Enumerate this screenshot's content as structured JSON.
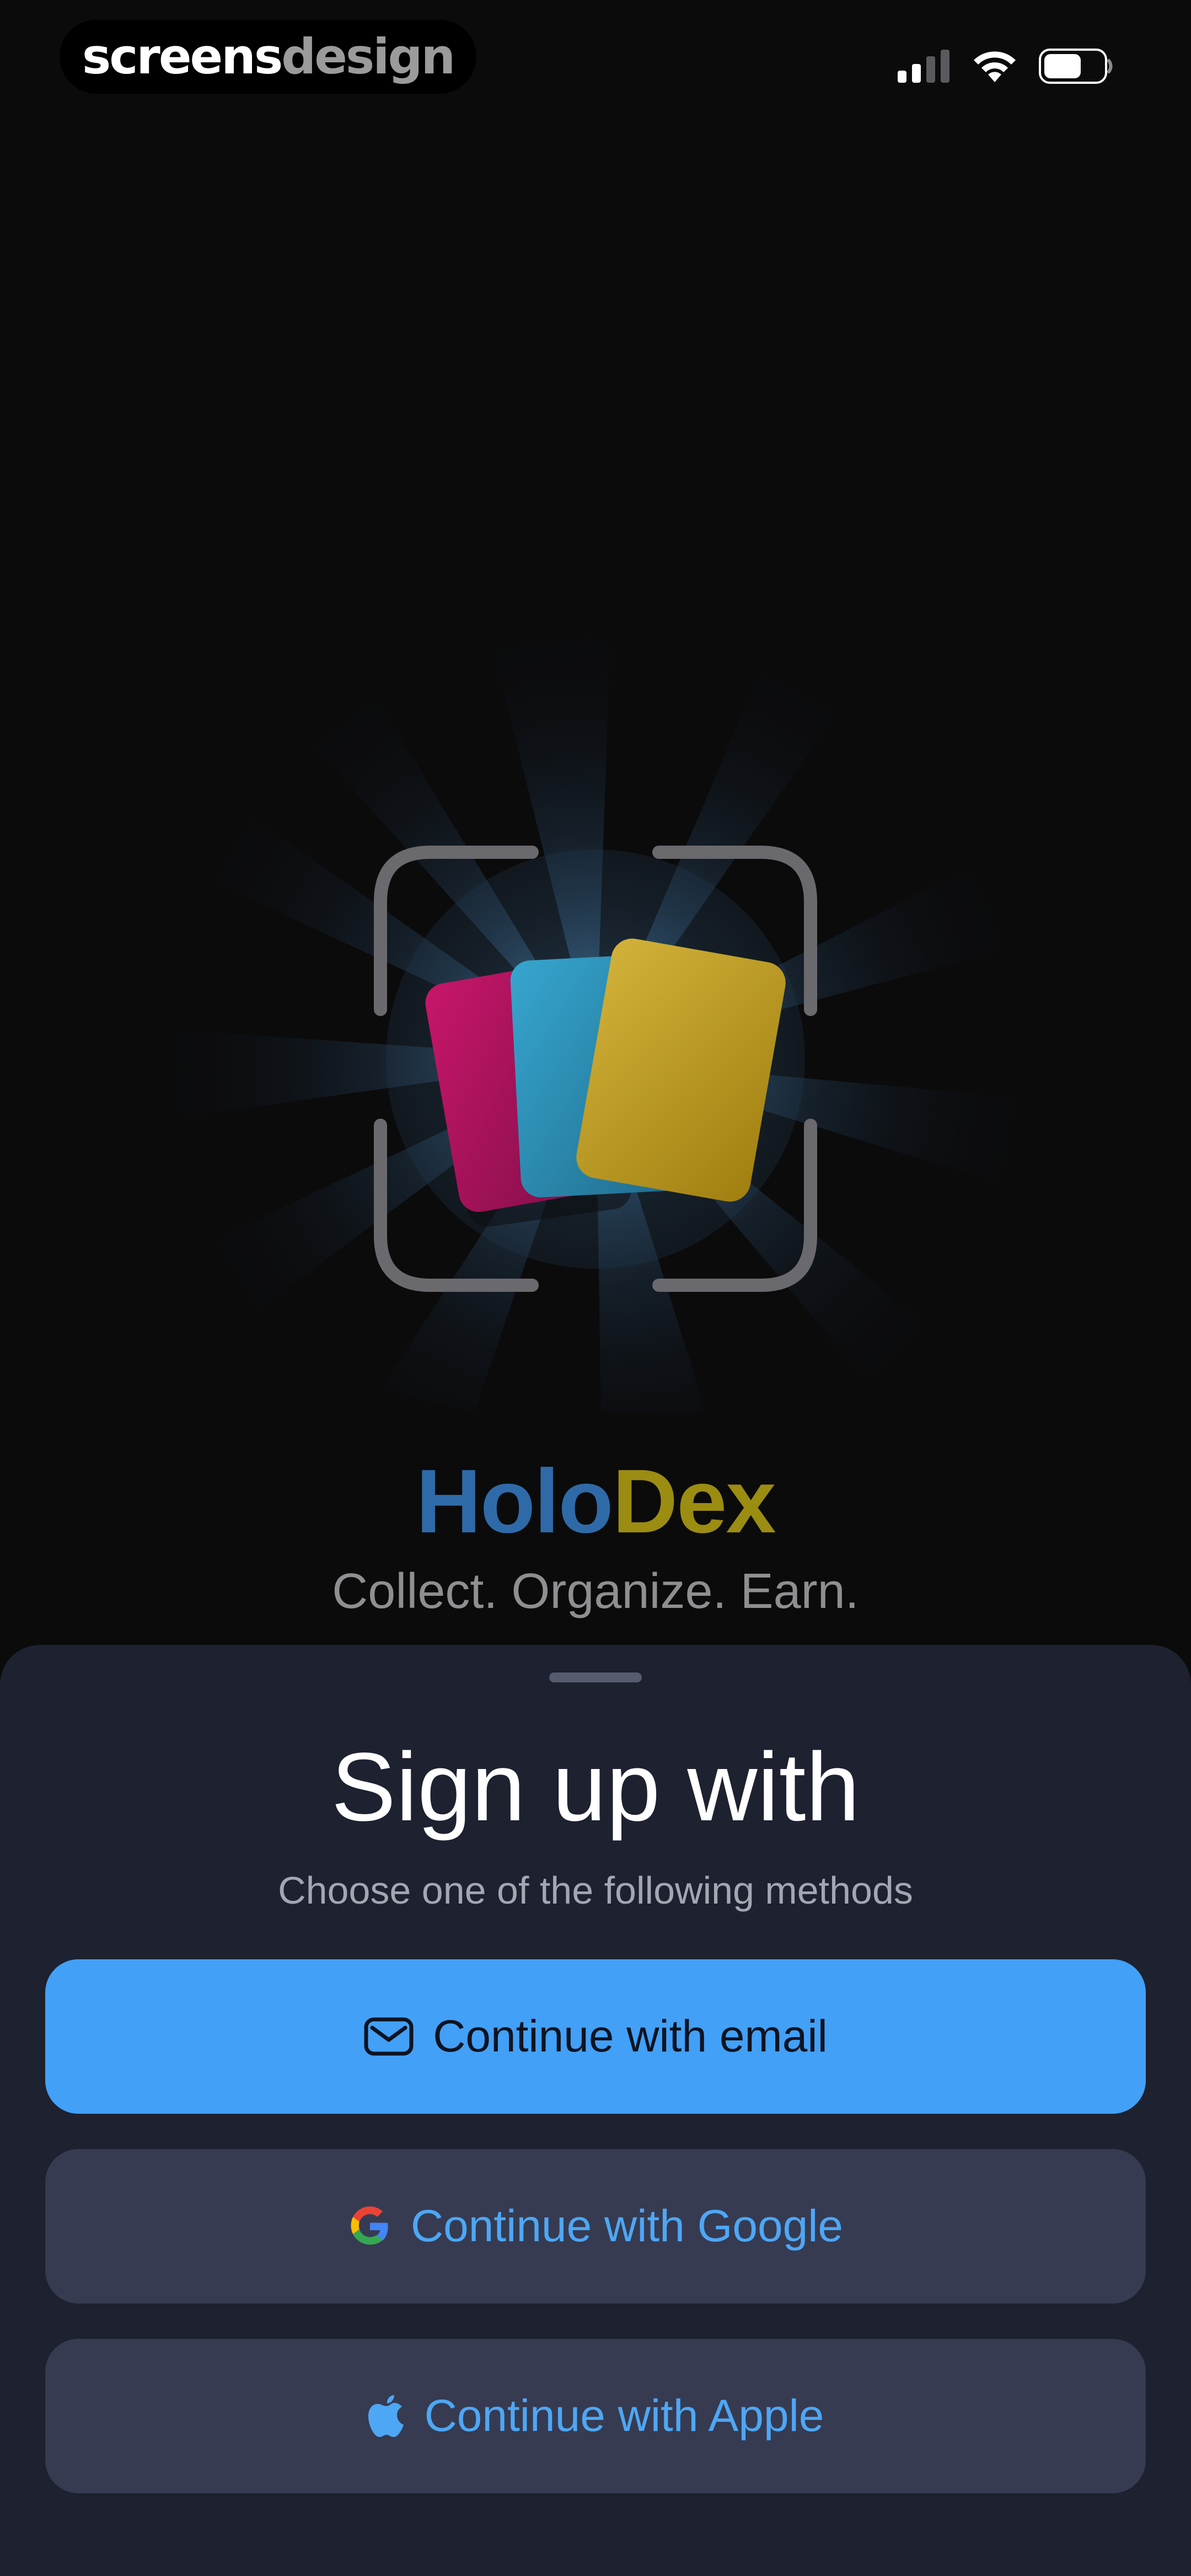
{
  "status_bar": {
    "brand_part1": "screens",
    "brand_part2": "design",
    "icons": [
      "cellular-signal-icon",
      "wifi-icon",
      "battery-icon"
    ]
  },
  "hero": {
    "app_name_part1": "Holo",
    "app_name_part2": "Dex",
    "tagline": "Collect. Organize. Earn.",
    "illustration": "trading-cards-scan-frame-icon",
    "colors": {
      "card_magenta": "#b0145f",
      "card_cyan": "#2a8bb0",
      "card_gold": "#b89a1c",
      "title_blue": "#2f6aa8",
      "title_gold": "#9b8c12"
    }
  },
  "sheet": {
    "title": "Sign up with",
    "subtitle": "Choose one of the following methods",
    "buttons": [
      {
        "label": "Continue with email",
        "icon": "envelope-icon"
      },
      {
        "label": "Continue with Google",
        "icon": "google-logo-icon"
      },
      {
        "label": "Continue with Apple",
        "icon": "apple-logo-icon"
      }
    ],
    "colors": {
      "primary": "#42a0f7",
      "secondary_bg": "#363b52",
      "sheet_bg": "#1d2130"
    }
  }
}
